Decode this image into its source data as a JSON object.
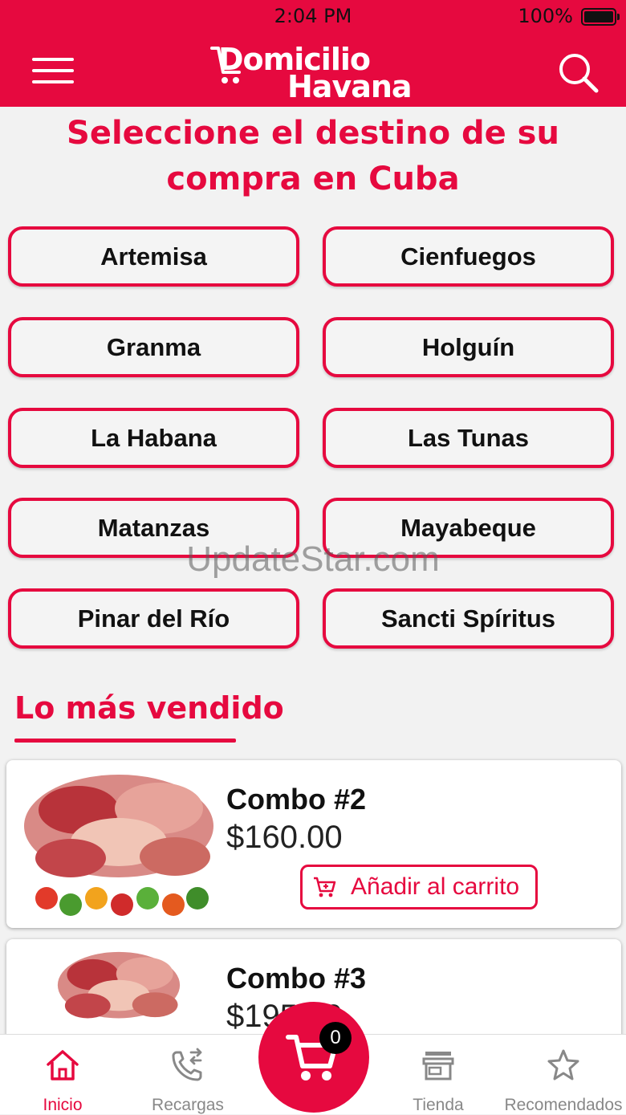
{
  "status_bar": {
    "time": "2:04 PM",
    "battery": "100%"
  },
  "header": {
    "logo_line1": "Domicilio",
    "logo_line2": "Havana"
  },
  "headline": "Seleccione el destino de su compra en Cuba",
  "provinces": [
    "Artemisa",
    "Cienfuegos",
    "Granma",
    "Holguín",
    "La Habana",
    "Las Tunas",
    "Matanzas",
    "Mayabeque",
    "Pinar del Río",
    "Sancti Spíritus"
  ],
  "best_sellers": {
    "title": "Lo más vendido",
    "add_to_cart_label": "Añadir al carrito",
    "products": [
      {
        "name": "Combo #2",
        "price": "$160.00"
      },
      {
        "name": "Combo #3",
        "price": "$195.00"
      }
    ]
  },
  "watermark": "UpdateStar.com",
  "cart": {
    "count": "0"
  },
  "bottom_nav": {
    "items": [
      {
        "label": "Inicio",
        "icon": "home-icon"
      },
      {
        "label": "Recargas",
        "icon": "phone-transfer-icon"
      },
      {
        "label": "Tienda",
        "icon": "store-icon"
      },
      {
        "label": "Recomendados",
        "icon": "star-icon"
      }
    ]
  },
  "colors": {
    "accent": "#e6093f",
    "background": "#f2f2f2"
  }
}
